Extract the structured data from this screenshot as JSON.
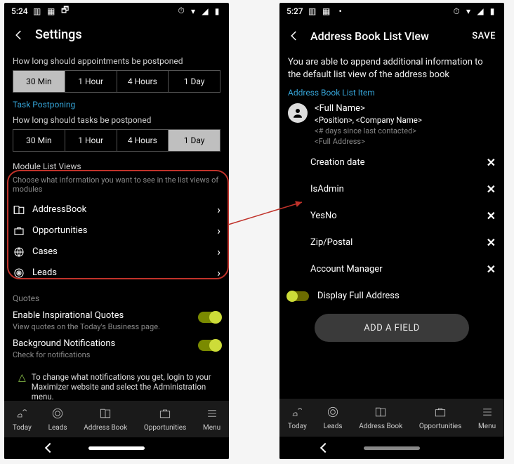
{
  "left": {
    "statusbar": {
      "time": "5:24"
    },
    "appbar": {
      "title": "Settings"
    },
    "appt": {
      "question": "How long should appointments be postponed",
      "options": [
        "30 Min",
        "1 Hour",
        "4 Hours",
        "1 Day"
      ],
      "activeIndex": 0
    },
    "task": {
      "link": "Task Postponing",
      "question": "How long should tasks be postponed",
      "options": [
        "30 Min",
        "1 Hour",
        "4 Hours",
        "1 Day"
      ],
      "activeIndex": 3
    },
    "module": {
      "heading": "Module List Views",
      "help": "Choose what information you want to see in the list views of modules",
      "items": [
        {
          "label": "AddressBook"
        },
        {
          "label": "Opportunities"
        },
        {
          "label": "Cases"
        },
        {
          "label": "Leads"
        }
      ]
    },
    "quotes": {
      "heading": "Quotes",
      "toggle1": {
        "label": "Enable Inspirational Quotes",
        "desc": "View quotes on the Today's Business page."
      },
      "toggle2": {
        "label": "Background Notifications",
        "desc": "Check for notifications"
      }
    },
    "warn": "To change what notifications you get, login to your Maximizer website and select the Administration menu.",
    "tabs": [
      "Today",
      "Leads",
      "Address Book",
      "Opportunities",
      "Menu"
    ]
  },
  "right": {
    "statusbar": {
      "time": "5:27"
    },
    "appbar": {
      "title": "Address Book List View",
      "save": "SAVE"
    },
    "description": "You are able to append additional information to the default list view of the address book",
    "section_link": "Address Book List Item",
    "profile": {
      "name": "<Full Name>",
      "position": "<Position>, <Company Name>",
      "days": "<# days since last contacted>",
      "address": "<Full Address>"
    },
    "fields": [
      "Creation date",
      "IsAdmin",
      "YesNo",
      "Zip/Postal",
      "Account Manager"
    ],
    "display_full": "Display Full Address",
    "add_button": "ADD A FIELD",
    "tabs": [
      "Today",
      "Leads",
      "Address Book",
      "Opportunities",
      "Menu"
    ]
  }
}
